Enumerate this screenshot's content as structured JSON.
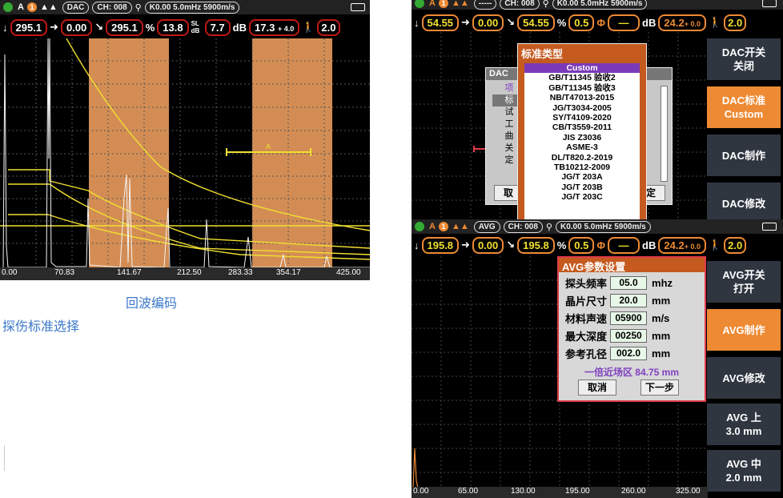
{
  "left": {
    "header": {
      "mode": "A",
      "step": "1",
      "curve": "DAC",
      "channel": "CH: 008",
      "probe": "K0.00  5.0mHz  5900m/s"
    },
    "values": {
      "v1": "295.1",
      "v2": "0.00",
      "v3": "295.1",
      "pct_sym": "%",
      "pct": "13.8",
      "sl_label": "SL dB",
      "sl": "7.7",
      "db_label": "dB",
      "gain": "17.3",
      "gain_offset": "+ 4.0",
      "step_val": "2.0"
    },
    "gate_label": "A",
    "xticks": [
      "0.00",
      "70.83",
      "141.67",
      "212.50",
      "283.33",
      "354.17",
      "425.00"
    ]
  },
  "captions": {
    "echo": "回波编码",
    "standard": "探伤标准选择"
  },
  "right_top": {
    "header": {
      "mode": "A",
      "step": "1",
      "curve": "-----",
      "channel": "CH: 008",
      "probe": "K0.00  5.0mHz  5900m/s"
    },
    "values": {
      "v1": "54.55",
      "v2": "0.00",
      "v3": "54.55",
      "pct_sym": "%",
      "pct": "0.5",
      "unit": "—",
      "db_label": "dB",
      "gain": "24.2",
      "gain_offset": "+ 0.0",
      "step_val": "2.0"
    },
    "dialog": {
      "title": "标准类型",
      "items": [
        "Custom",
        "GB/T11345 验收2",
        "GB/T11345 验收3",
        "NB/T47013-2015",
        "JG/T3034-2005",
        "SY/T4109-2020",
        "CB/T3559-2011",
        "JIS Z3036",
        "ASME-3",
        "DL/T820.2-2019",
        "TB10212-2009",
        "JG/T 203A",
        "JG/T 203B",
        "JG/T 203C"
      ],
      "selected": 0
    },
    "behind": {
      "title": "DAC",
      "rows": [
        "项",
        "标",
        "试",
        "工",
        "曲",
        "关",
        "定"
      ],
      "cancel": "取",
      "confirm": "定"
    },
    "side": [
      {
        "label": "DAC开关\n关闭",
        "active": false
      },
      {
        "label": "DAC标准\nCustom",
        "active": true
      },
      {
        "label": "DAC制作",
        "active": false
      },
      {
        "label": "DAC修改",
        "active": false
      }
    ]
  },
  "right_bottom": {
    "header": {
      "mode": "A",
      "step": "1",
      "curve": "AVG",
      "channel": "CH: 008",
      "probe": "K0.00  5.0mHz  5900m/s"
    },
    "values": {
      "v1": "195.8",
      "v2": "0.00",
      "v3": "195.8",
      "pct_sym": "%",
      "pct": "0.5",
      "unit": "—",
      "db_label": "dB",
      "gain": "24.2",
      "gain_offset": "+ 0.0",
      "step_val": "2.0"
    },
    "dialog": {
      "title": "AVG参数设置",
      "fields": [
        {
          "label": "探头频率",
          "value": "05.0",
          "unit": "mhz"
        },
        {
          "label": "晶片尺寸",
          "value": "20.0",
          "unit": "mm"
        },
        {
          "label": "材料声速",
          "value": "05900",
          "unit": "m/s"
        },
        {
          "label": "最大深度",
          "value": "00250",
          "unit": "mm"
        },
        {
          "label": "参考孔径",
          "value": "002.0",
          "unit": "mm"
        }
      ],
      "near_field": "一倍近场区 84.75 mm",
      "cancel": "取消",
      "next": "下一步"
    },
    "side": [
      {
        "label": "AVG开关\n打开",
        "active": false
      },
      {
        "label": "AVG制作",
        "active": true
      },
      {
        "label": "AVG修改",
        "active": false
      },
      {
        "label": "AVG 上\n3.0 mm",
        "active": false
      },
      {
        "label": "AVG 中\n2.0 mm",
        "active": false
      }
    ],
    "xticks": [
      "0.00",
      "65.00",
      "130.00",
      "195.00",
      "260.00",
      "325.00"
    ]
  },
  "colors": {
    "accent": "#ee8a33",
    "border_red": "#c01818",
    "curve_yellow": "#f0e030",
    "gate_orange": "#f0a060"
  }
}
